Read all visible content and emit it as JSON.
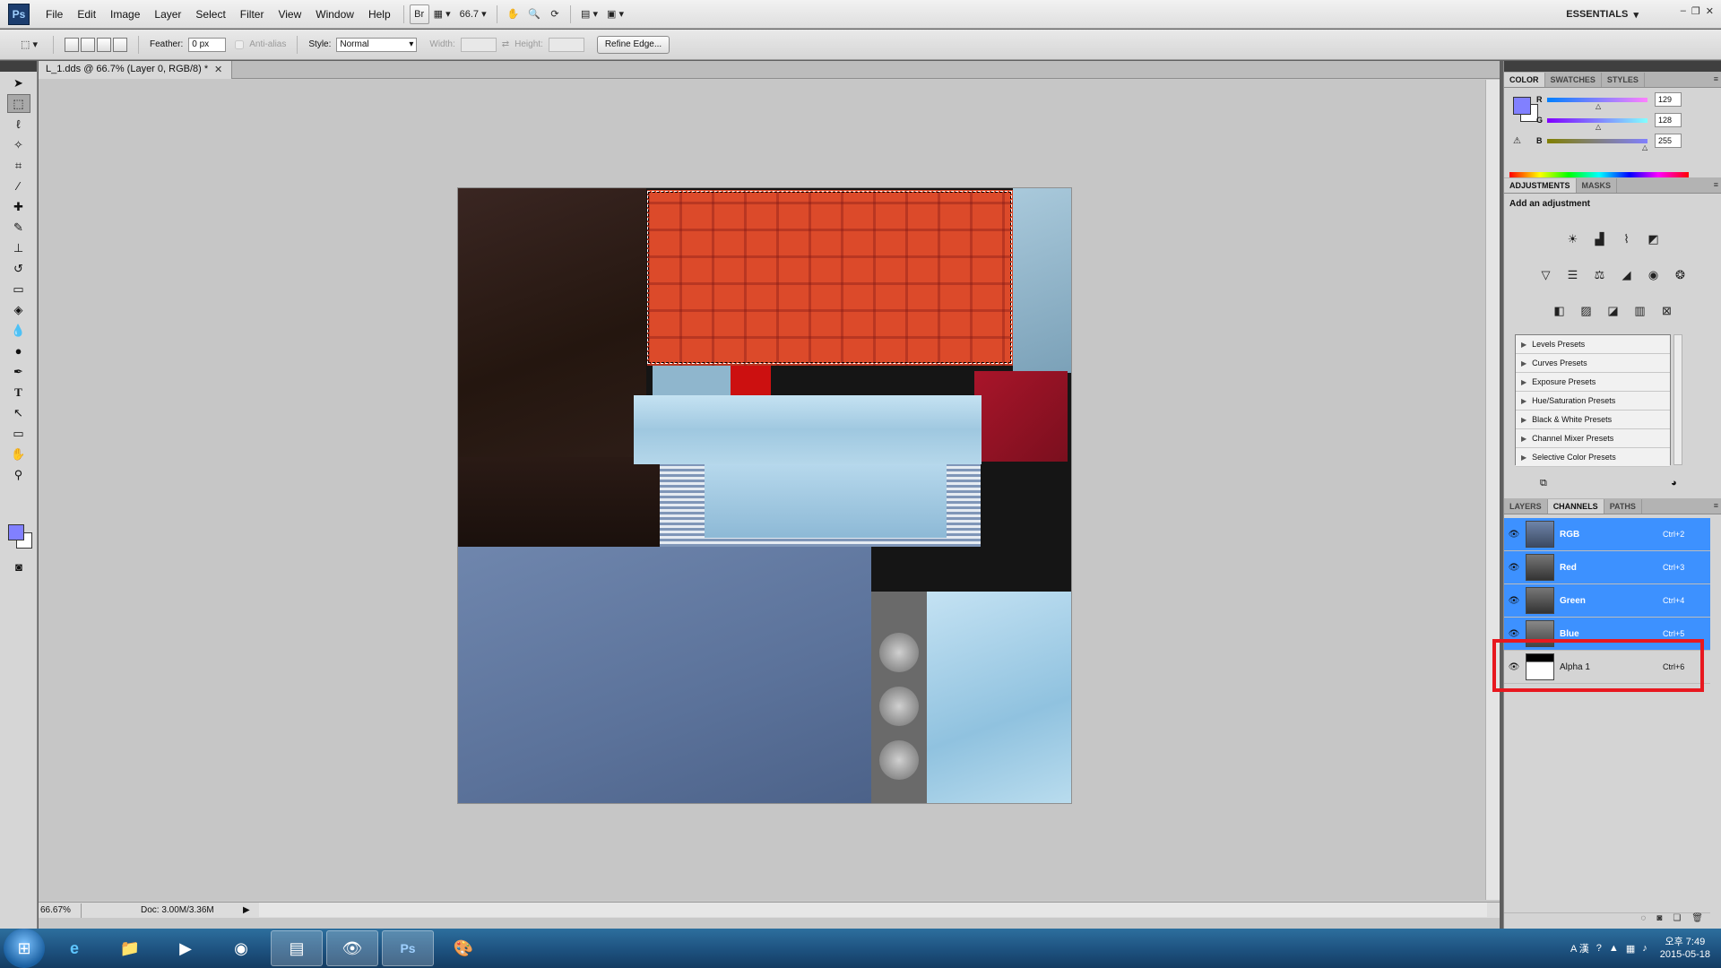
{
  "menubar": {
    "logo": "Ps",
    "items": [
      "File",
      "Edit",
      "Image",
      "Layer",
      "Select",
      "Filter",
      "View",
      "Window",
      "Help"
    ],
    "bridge": "Br",
    "zoom": "66.7",
    "workspace": "ESSENTIALS"
  },
  "options": {
    "feather_label": "Feather:",
    "feather_value": "0 px",
    "antialias_label": "Anti-alias",
    "style_label": "Style:",
    "style_value": "Normal",
    "width_label": "Width:",
    "height_label": "Height:",
    "refine_label": "Refine Edge..."
  },
  "document": {
    "tab_title": "L_1.dds @ 66.7% (Layer 0, RGB/8) *",
    "status_zoom": "66.67%",
    "status_doc": "Doc: 3.00M/3.36M"
  },
  "color_panel": {
    "tabs": [
      "COLOR",
      "SWATCHES",
      "STYLES"
    ],
    "channels": [
      {
        "label": "R",
        "value": "129",
        "level": 0.506
      },
      {
        "label": "G",
        "value": "128",
        "level": 0.502
      },
      {
        "label": "B",
        "value": "255",
        "level": 1.0
      }
    ],
    "foreground": "#8180ff"
  },
  "adjustments": {
    "tabs": [
      "ADJUSTMENTS",
      "MASKS"
    ],
    "title": "Add an adjustment",
    "presets": [
      "Levels Presets",
      "Curves Presets",
      "Exposure Presets",
      "Hue/Saturation Presets",
      "Black & White Presets",
      "Channel Mixer Presets",
      "Selective Color Presets"
    ]
  },
  "channels_panel": {
    "tabs": [
      "LAYERS",
      "CHANNELS",
      "PATHS"
    ],
    "rows": [
      {
        "name": "RGB",
        "shortcut": "Ctrl+2"
      },
      {
        "name": "Red",
        "shortcut": "Ctrl+3"
      },
      {
        "name": "Green",
        "shortcut": "Ctrl+4"
      },
      {
        "name": "Blue",
        "shortcut": "Ctrl+5"
      },
      {
        "name": "Alpha 1",
        "shortcut": "Ctrl+6"
      }
    ]
  },
  "taskbar": {
    "time": "오후 7:49",
    "date": "2015-05-18",
    "tray_lang": "A 漢"
  },
  "colors": {
    "selection_blue": "#3d91ff",
    "highlight_red": "#e8181f"
  }
}
